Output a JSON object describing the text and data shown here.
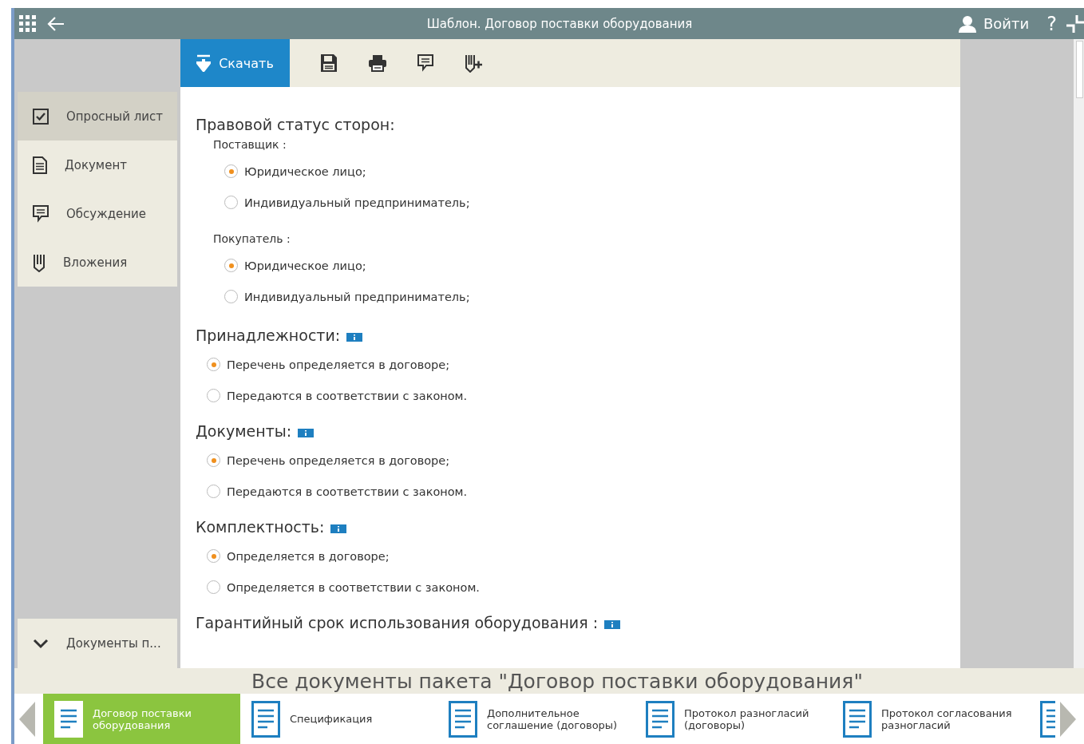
{
  "header": {
    "title": "Шаблон. Договор поставки оборудования",
    "login": "Войти",
    "help": "?"
  },
  "toolbar": {
    "download": "Скачать",
    "tools": [
      {
        "kind": "save"
      },
      {
        "kind": "print"
      },
      {
        "kind": "comment"
      },
      {
        "kind": "attach"
      }
    ]
  },
  "sidebar": {
    "items": [
      {
        "label": "Опросный лист",
        "selected": true
      },
      {
        "label": "Документ",
        "selected": false
      },
      {
        "label": "Обсуждение",
        "selected": false
      },
      {
        "label": "Вложения",
        "selected": false
      }
    ],
    "packages": {
      "label": "Документы п...",
      "expanded": true
    }
  },
  "sections": [
    {
      "title": "Правовой статус сторон:",
      "info": false,
      "groups": [
        {
          "label": "Поставщик :",
          "options": [
            {
              "label": "Юридическое лицо;",
              "selected": true
            },
            {
              "label": "Индивидуальный предприниматель;",
              "selected": false
            }
          ]
        },
        {
          "label": "Покупатель :",
          "options": [
            {
              "label": "Юридическое лицо;",
              "selected": true
            },
            {
              "label": "Индивидуальный предприниматель;",
              "selected": false
            }
          ]
        }
      ]
    },
    {
      "title": "Принадлежности:",
      "info": true,
      "groups": [
        {
          "options": [
            {
              "label": "Перечень определяется в договоре;",
              "selected": true
            },
            {
              "label": "Передаются в соответствии с законом.",
              "selected": false
            }
          ]
        }
      ]
    },
    {
      "title": "Документы:",
      "info": true,
      "groups": [
        {
          "options": [
            {
              "label": "Перечень определяется в договоре;",
              "selected": true
            },
            {
              "label": "Передаются в соответствии с законом.",
              "selected": false
            }
          ]
        }
      ]
    },
    {
      "title": "Комплектность:",
      "info": true,
      "groups": [
        {
          "options": [
            {
              "label": "Определяется в договоре;",
              "selected": true
            },
            {
              "label": "Определяется в соответствии с законом.",
              "selected": false
            }
          ]
        }
      ]
    },
    {
      "title": "Гарантийный срок использования  оборудования :",
      "info": true
    }
  ],
  "package": {
    "title": "Все документы пакета \"Договор поставки оборудования\"",
    "documents": [
      {
        "kind": "full",
        "label": "Договор поставки оборудования",
        "selected": true
      },
      {
        "kind": "full",
        "label": "Спецификация",
        "selected": false
      },
      {
        "kind": "full",
        "label": "Дополнительное соглашение (договоры)",
        "selected": false
      },
      {
        "kind": "full",
        "label": "Протокол разногласий (договоры)",
        "selected": false
      },
      {
        "kind": "full",
        "label": "Протокол согласования разногласий",
        "selected": false
      },
      {
        "kind": "partial",
        "selected": false
      }
    ]
  }
}
